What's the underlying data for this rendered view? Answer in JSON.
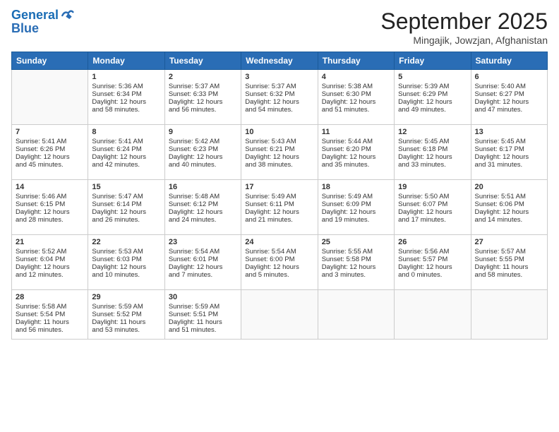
{
  "header": {
    "logo_line1": "General",
    "logo_line2": "Blue",
    "month_title": "September 2025",
    "location": "Mingajik, Jowzjan, Afghanistan"
  },
  "days_of_week": [
    "Sunday",
    "Monday",
    "Tuesday",
    "Wednesday",
    "Thursday",
    "Friday",
    "Saturday"
  ],
  "weeks": [
    [
      {
        "day": "",
        "content": ""
      },
      {
        "day": "1",
        "content": "Sunrise: 5:36 AM\nSunset: 6:34 PM\nDaylight: 12 hours\nand 58 minutes."
      },
      {
        "day": "2",
        "content": "Sunrise: 5:37 AM\nSunset: 6:33 PM\nDaylight: 12 hours\nand 56 minutes."
      },
      {
        "day": "3",
        "content": "Sunrise: 5:37 AM\nSunset: 6:32 PM\nDaylight: 12 hours\nand 54 minutes."
      },
      {
        "day": "4",
        "content": "Sunrise: 5:38 AM\nSunset: 6:30 PM\nDaylight: 12 hours\nand 51 minutes."
      },
      {
        "day": "5",
        "content": "Sunrise: 5:39 AM\nSunset: 6:29 PM\nDaylight: 12 hours\nand 49 minutes."
      },
      {
        "day": "6",
        "content": "Sunrise: 5:40 AM\nSunset: 6:27 PM\nDaylight: 12 hours\nand 47 minutes."
      }
    ],
    [
      {
        "day": "7",
        "content": "Sunrise: 5:41 AM\nSunset: 6:26 PM\nDaylight: 12 hours\nand 45 minutes."
      },
      {
        "day": "8",
        "content": "Sunrise: 5:41 AM\nSunset: 6:24 PM\nDaylight: 12 hours\nand 42 minutes."
      },
      {
        "day": "9",
        "content": "Sunrise: 5:42 AM\nSunset: 6:23 PM\nDaylight: 12 hours\nand 40 minutes."
      },
      {
        "day": "10",
        "content": "Sunrise: 5:43 AM\nSunset: 6:21 PM\nDaylight: 12 hours\nand 38 minutes."
      },
      {
        "day": "11",
        "content": "Sunrise: 5:44 AM\nSunset: 6:20 PM\nDaylight: 12 hours\nand 35 minutes."
      },
      {
        "day": "12",
        "content": "Sunrise: 5:45 AM\nSunset: 6:18 PM\nDaylight: 12 hours\nand 33 minutes."
      },
      {
        "day": "13",
        "content": "Sunrise: 5:45 AM\nSunset: 6:17 PM\nDaylight: 12 hours\nand 31 minutes."
      }
    ],
    [
      {
        "day": "14",
        "content": "Sunrise: 5:46 AM\nSunset: 6:15 PM\nDaylight: 12 hours\nand 28 minutes."
      },
      {
        "day": "15",
        "content": "Sunrise: 5:47 AM\nSunset: 6:14 PM\nDaylight: 12 hours\nand 26 minutes."
      },
      {
        "day": "16",
        "content": "Sunrise: 5:48 AM\nSunset: 6:12 PM\nDaylight: 12 hours\nand 24 minutes."
      },
      {
        "day": "17",
        "content": "Sunrise: 5:49 AM\nSunset: 6:11 PM\nDaylight: 12 hours\nand 21 minutes."
      },
      {
        "day": "18",
        "content": "Sunrise: 5:49 AM\nSunset: 6:09 PM\nDaylight: 12 hours\nand 19 minutes."
      },
      {
        "day": "19",
        "content": "Sunrise: 5:50 AM\nSunset: 6:07 PM\nDaylight: 12 hours\nand 17 minutes."
      },
      {
        "day": "20",
        "content": "Sunrise: 5:51 AM\nSunset: 6:06 PM\nDaylight: 12 hours\nand 14 minutes."
      }
    ],
    [
      {
        "day": "21",
        "content": "Sunrise: 5:52 AM\nSunset: 6:04 PM\nDaylight: 12 hours\nand 12 minutes."
      },
      {
        "day": "22",
        "content": "Sunrise: 5:53 AM\nSunset: 6:03 PM\nDaylight: 12 hours\nand 10 minutes."
      },
      {
        "day": "23",
        "content": "Sunrise: 5:54 AM\nSunset: 6:01 PM\nDaylight: 12 hours\nand 7 minutes."
      },
      {
        "day": "24",
        "content": "Sunrise: 5:54 AM\nSunset: 6:00 PM\nDaylight: 12 hours\nand 5 minutes."
      },
      {
        "day": "25",
        "content": "Sunrise: 5:55 AM\nSunset: 5:58 PM\nDaylight: 12 hours\nand 3 minutes."
      },
      {
        "day": "26",
        "content": "Sunrise: 5:56 AM\nSunset: 5:57 PM\nDaylight: 12 hours\nand 0 minutes."
      },
      {
        "day": "27",
        "content": "Sunrise: 5:57 AM\nSunset: 5:55 PM\nDaylight: 11 hours\nand 58 minutes."
      }
    ],
    [
      {
        "day": "28",
        "content": "Sunrise: 5:58 AM\nSunset: 5:54 PM\nDaylight: 11 hours\nand 56 minutes."
      },
      {
        "day": "29",
        "content": "Sunrise: 5:59 AM\nSunset: 5:52 PM\nDaylight: 11 hours\nand 53 minutes."
      },
      {
        "day": "30",
        "content": "Sunrise: 5:59 AM\nSunset: 5:51 PM\nDaylight: 11 hours\nand 51 minutes."
      },
      {
        "day": "",
        "content": ""
      },
      {
        "day": "",
        "content": ""
      },
      {
        "day": "",
        "content": ""
      },
      {
        "day": "",
        "content": ""
      }
    ]
  ]
}
